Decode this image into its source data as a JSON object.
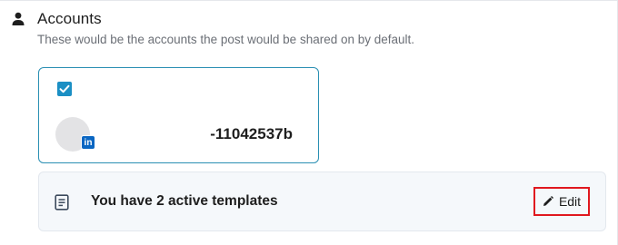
{
  "section": {
    "title": "Accounts",
    "description": "These would be the accounts the post would be shared on by default.",
    "icon": "person-icon"
  },
  "account": {
    "checked": true,
    "name": "-11042537b",
    "network": "linkedin",
    "network_badge": "in",
    "accent_color": "#1b8fc4"
  },
  "templates": {
    "text": "You have 2 active templates",
    "icon": "document-icon",
    "edit_label": "Edit",
    "edit_icon": "pencil-icon",
    "highlight_color": "#e0181f"
  }
}
